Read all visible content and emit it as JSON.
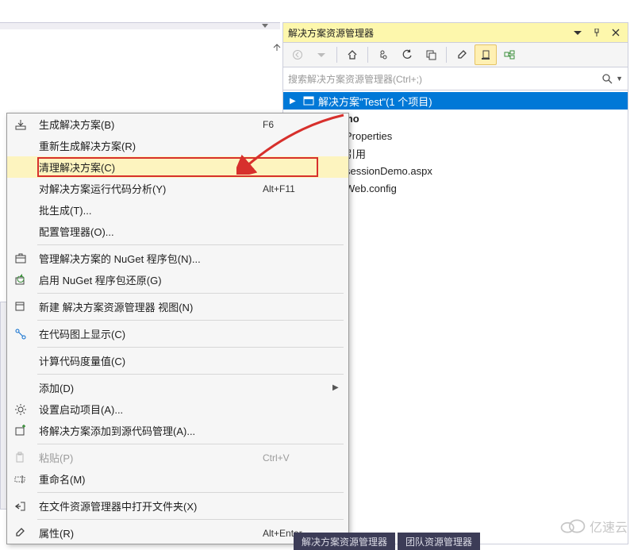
{
  "panel": {
    "title": "解决方案资源管理器",
    "search_placeholder": "搜索解决方案资源管理器(Ctrl+;)"
  },
  "tree": {
    "root": "解决方案\"Test\"(1 个项目)",
    "proj_suffix": "stDemo",
    "items": [
      "Properties",
      "引用",
      "sessionDemo.aspx",
      "Web.config"
    ]
  },
  "ctx": {
    "build": {
      "label": "生成解决方案(B)",
      "shortcut": "F6"
    },
    "rebuild": {
      "label": "重新生成解决方案(R)",
      "shortcut": ""
    },
    "clean": {
      "label": "清理解决方案(C)",
      "shortcut": ""
    },
    "analyze": {
      "label": "对解决方案运行代码分析(Y)",
      "shortcut": "Alt+F11"
    },
    "batch": {
      "label": "批生成(T)...",
      "shortcut": ""
    },
    "cfg": {
      "label": "配置管理器(O)...",
      "shortcut": ""
    },
    "nuget": {
      "label": "管理解决方案的 NuGet 程序包(N)...",
      "shortcut": ""
    },
    "nuget_restore": {
      "label": "启用 NuGet 程序包还原(G)",
      "shortcut": ""
    },
    "newview": {
      "label": "新建 解决方案资源管理器 视图(N)",
      "shortcut": ""
    },
    "codemap": {
      "label": "在代码图上显示(C)",
      "shortcut": ""
    },
    "metrics": {
      "label": "计算代码度量值(C)",
      "shortcut": ""
    },
    "add": {
      "label": "添加(D)",
      "shortcut": ""
    },
    "startup": {
      "label": "设置启动项目(A)...",
      "shortcut": ""
    },
    "addsrc": {
      "label": "将解决方案添加到源代码管理(A)...",
      "shortcut": ""
    },
    "paste": {
      "label": "粘贴(P)",
      "shortcut": "Ctrl+V"
    },
    "rename": {
      "label": "重命名(M)",
      "shortcut": ""
    },
    "openfolder": {
      "label": "在文件资源管理器中打开文件夹(X)",
      "shortcut": ""
    },
    "props": {
      "label": "属性(R)",
      "shortcut": "Alt+Enter"
    }
  },
  "bottom_tabs": [
    "解决方案资源管理器",
    "团队资源管理器"
  ],
  "watermark": "亿速云"
}
